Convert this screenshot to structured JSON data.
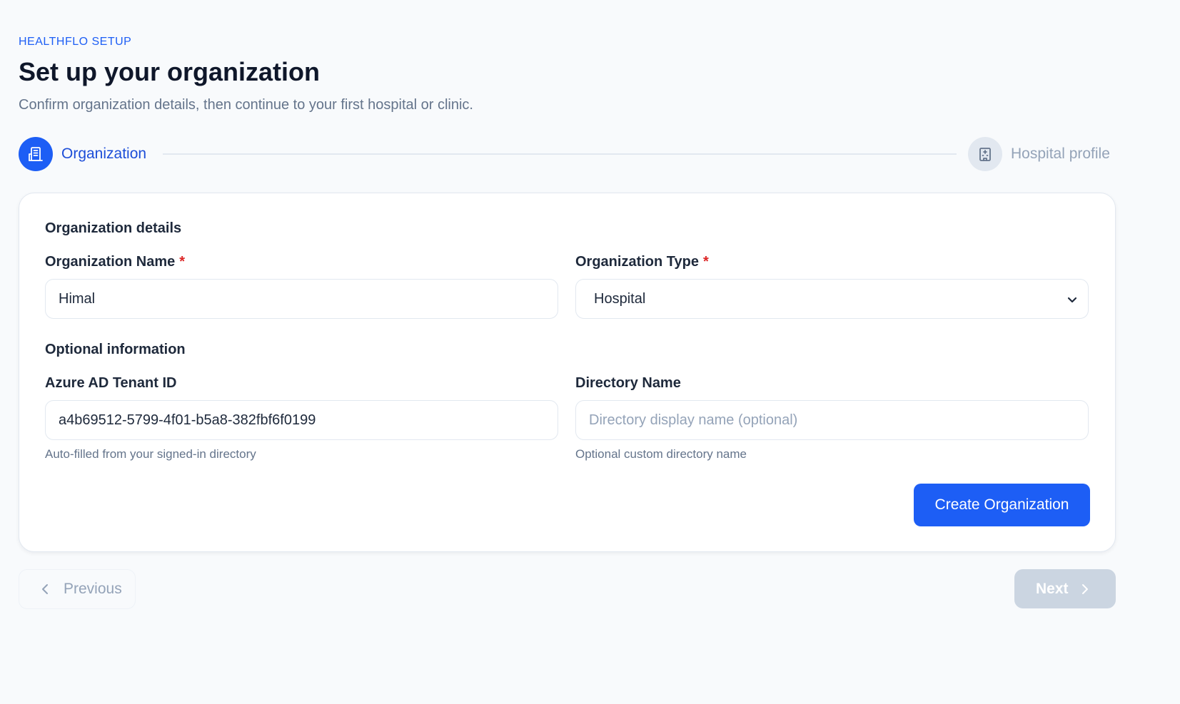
{
  "header": {
    "eyebrow": "HEALTHFLO SETUP",
    "title": "Set up your organization",
    "subtitle": "Confirm organization details, then continue to your first hospital or clinic."
  },
  "stepper": {
    "steps": [
      {
        "label": "Organization",
        "icon": "building-icon",
        "state": "active"
      },
      {
        "label": "Hospital profile",
        "icon": "hospital-icon",
        "state": "inactive"
      }
    ]
  },
  "form": {
    "section_details": "Organization details",
    "org_name": {
      "label": "Organization Name",
      "required_mark": "*",
      "value": "Himal"
    },
    "org_type": {
      "label": "Organization Type",
      "required_mark": "*",
      "value": "Hospital",
      "icon": "chevron-down-icon"
    },
    "section_optional": "Optional information",
    "tenant_id": {
      "label": "Azure AD Tenant ID",
      "value": "a4b69512-5799-4f01-b5a8-382fbf6f0199",
      "help": "Auto-filled from your signed-in directory"
    },
    "directory_name": {
      "label": "Directory Name",
      "placeholder": "Directory display name (optional)",
      "help": "Optional custom directory name"
    },
    "submit_label": "Create Organization"
  },
  "nav": {
    "previous_label": "Previous",
    "previous_icon": "chevron-left-icon",
    "next_label": "Next",
    "next_icon": "chevron-right-icon"
  },
  "colors": {
    "accent": "#1d5ef5",
    "required": "#dc2626",
    "disabled": "#cbd5e1"
  }
}
